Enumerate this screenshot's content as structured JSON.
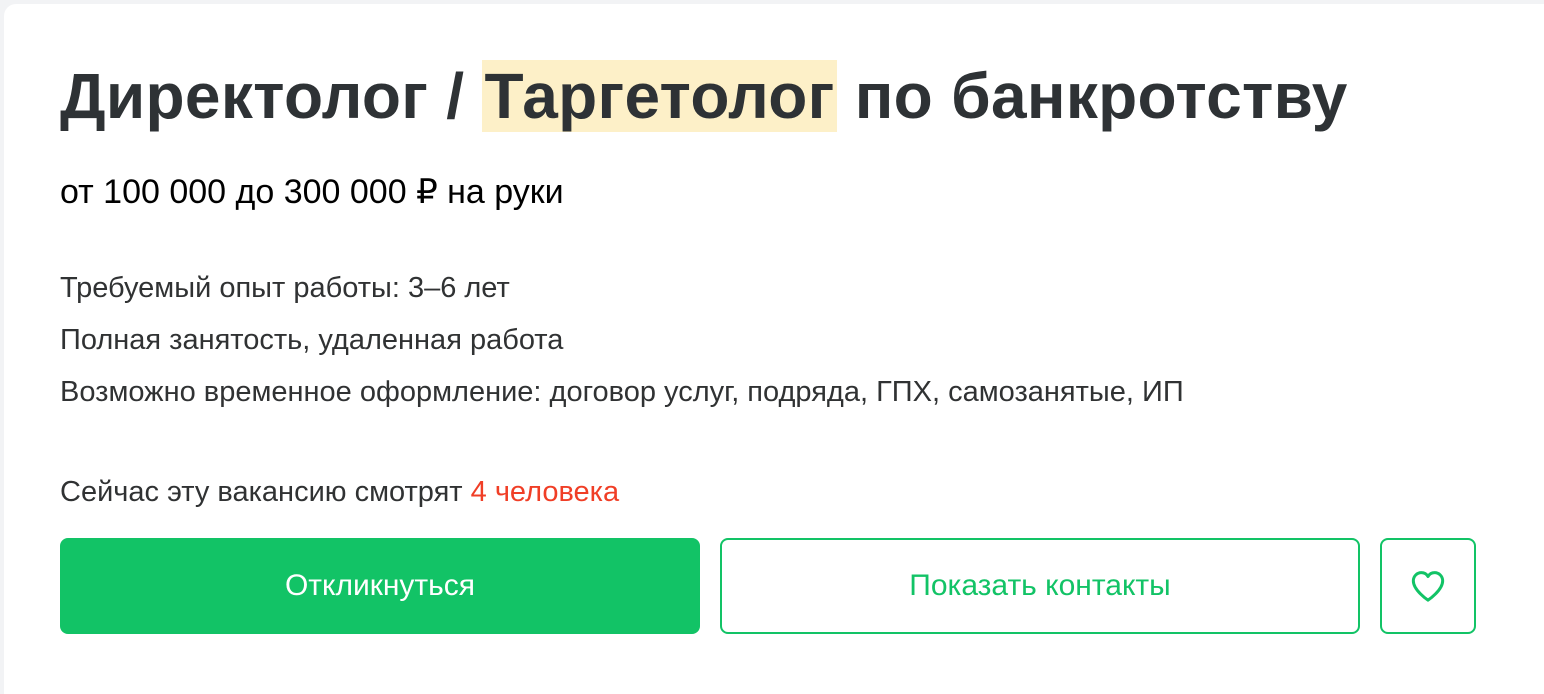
{
  "vacancy": {
    "title_prefix": "Директолог / ",
    "title_highlight": "Таргетолог",
    "title_suffix": " по банкротству",
    "salary": "от 100 000 до 300 000 ₽ на руки",
    "experience": "Требуемый опыт работы: 3–6 лет",
    "employment": "Полная занятость, удаленная работа",
    "contract": "Возможно временное оформление: договор услуг, подряда, ГПХ, самозанятые, ИП",
    "viewers_text": "Сейчас эту вакансию смотрят ",
    "viewers_count": "4 человека"
  },
  "actions": {
    "respond_label": "Откликнуться",
    "contacts_label": "Показать контакты",
    "favorite_icon": "heart-icon"
  },
  "colors": {
    "accent": "#12c366",
    "highlight": "#fdf0c8",
    "viewers_count": "#f03e26",
    "text": "#303233"
  }
}
